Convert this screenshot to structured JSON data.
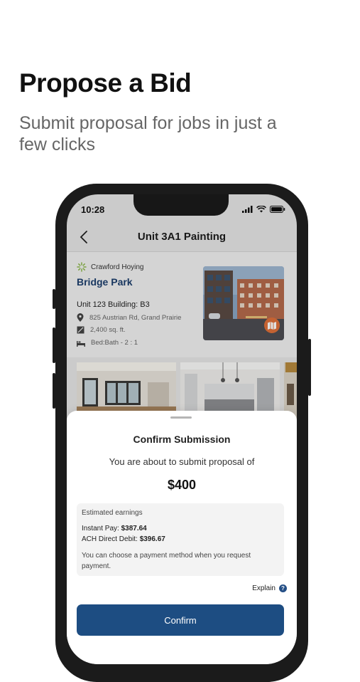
{
  "promo": {
    "headline": "Propose a Bid",
    "subheadline": "Submit proposal for jobs in just a few clicks"
  },
  "status_bar": {
    "time": "10:28"
  },
  "nav": {
    "title": "Unit 3A1 Painting",
    "back_icon": "chevron-left-icon"
  },
  "property": {
    "company": "Crawford Hoying",
    "name": "Bridge Park",
    "unit_line": "Unit 123  Building: B3",
    "address": "825 Austrian Rd, Grand Prairie",
    "area": "2,400 sq. ft.",
    "bed_bath": "Bed:Bath - 2 : 1"
  },
  "confirm_sheet": {
    "title": "Confirm Submission",
    "message": "You are about to submit proposal of",
    "amount": "$400",
    "earnings_title": "Estimated earnings",
    "instant_pay_label": "Instant Pay:",
    "instant_pay_value": "$387.64",
    "ach_label": "ACH Direct Debit:",
    "ach_value": "$396.67",
    "note": "You can choose a payment method when you request payment.",
    "explain_label": "Explain",
    "confirm_label": "Confirm"
  },
  "colors": {
    "brand_blue": "#1d4d82",
    "title_blue": "#1d3f6e",
    "map_badge": "#e0703a"
  }
}
